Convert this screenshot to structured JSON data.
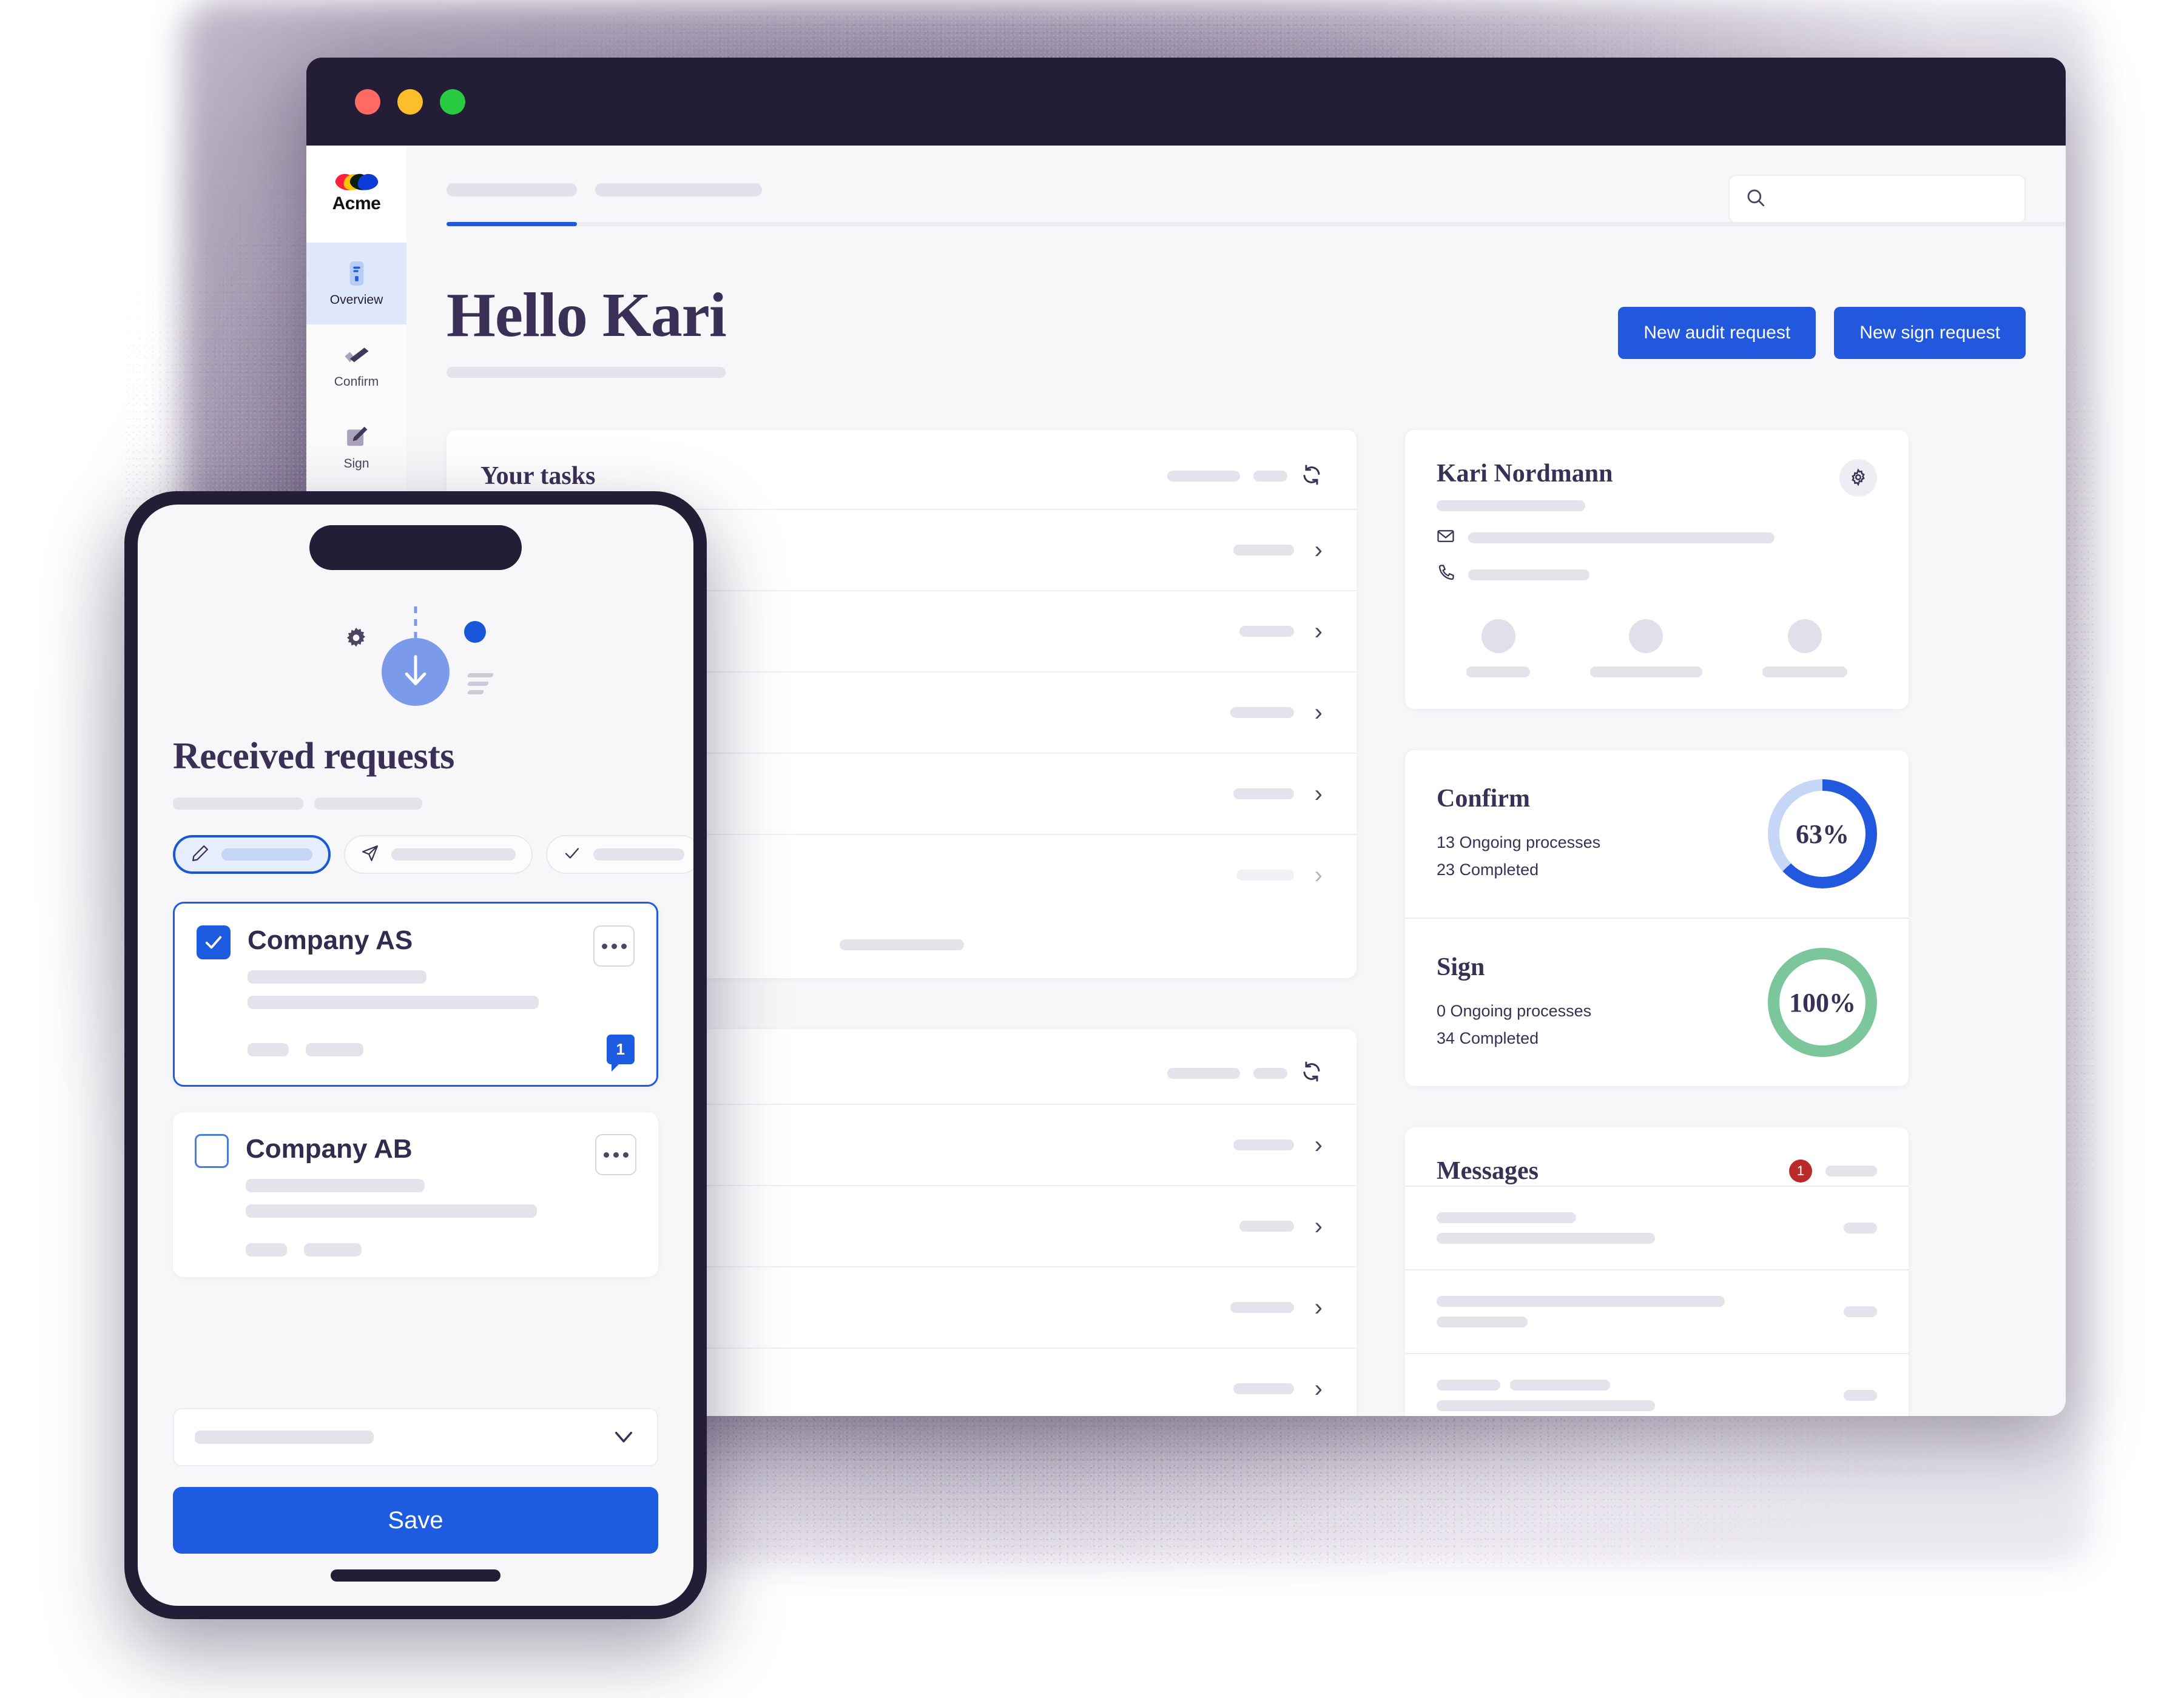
{
  "window": {
    "traffic_lights": [
      "close-red",
      "minimize-yellow",
      "maximize-green"
    ]
  },
  "sidebar": {
    "brand": "Acme",
    "items": [
      {
        "label": "Overview",
        "icon": "document-icon",
        "active": true
      },
      {
        "label": "Confirm",
        "icon": "checkmark-brush-icon",
        "active": false
      },
      {
        "label": "Sign",
        "icon": "pencil-square-icon",
        "active": false
      }
    ]
  },
  "topbar": {
    "search_placeholder": "",
    "search_value": "",
    "search_icon": "search-icon"
  },
  "header": {
    "greeting": "Hello Kari",
    "buttons": [
      {
        "label": "New audit request",
        "name": "new-audit-request-button"
      },
      {
        "label": "New sign request",
        "name": "new-sign-request-button"
      }
    ]
  },
  "tasks_card": {
    "title": "Your tasks",
    "refresh_icon": "refresh-icon",
    "rows": 5
  },
  "tasks_card_2": {
    "title": "",
    "refresh_icon": "refresh-icon",
    "rows": 5
  },
  "profile": {
    "name": "Kari Nordmann",
    "settings_icon": "gear-icon",
    "email_icon": "envelope-icon",
    "phone_icon": "phone-icon",
    "people_count": 3
  },
  "stats": [
    {
      "title": "Confirm",
      "ongoing": "13 Ongoing processes",
      "completed": "23 Completed",
      "percent_label": "63%",
      "percent": 63,
      "color": "#2258dd",
      "track_color": "#c6d6f7"
    },
    {
      "title": "Sign",
      "ongoing": "0 Ongoing processes",
      "completed": "34 Completed",
      "percent_label": "100%",
      "percent": 100,
      "color": "#7bc69a",
      "track_color": "#7bc69a"
    }
  ],
  "messages": {
    "title": "Messages",
    "unread_count": "1",
    "unread_color": "#b92b2b",
    "rows": 4
  },
  "phone": {
    "illustration": {
      "arrow_icon": "download-arrow-icon",
      "gear_icon": "gear-icon",
      "dot_icon": "dot-icon",
      "lines_icon": "motion-lines-icon"
    },
    "title": "Received requests",
    "filters": [
      {
        "icon": "pencil-icon",
        "active": true
      },
      {
        "icon": "paper-plane-icon",
        "active": false
      },
      {
        "icon": "check-icon",
        "active": false
      }
    ],
    "requests": [
      {
        "name": "Company AS",
        "checked": true,
        "selected": true,
        "menu_icon": "kebab-menu-icon",
        "chat_badge": "1"
      },
      {
        "name": "Company AB",
        "checked": false,
        "selected": false,
        "menu_icon": "kebab-menu-icon",
        "chat_badge": null
      }
    ],
    "select": {
      "value": "",
      "chevron_icon": "chevron-down-icon"
    },
    "save_label": "Save"
  },
  "colors": {
    "brand_blue": "#2258dd",
    "accent_blue": "#1d5ce0",
    "dark_navy": "#241d36",
    "text_purple": "#3a3055",
    "green": "#7bc69a",
    "red": "#b92b2b",
    "skeleton": "#e3e3ec",
    "page_bg": "#f7f7f9"
  }
}
